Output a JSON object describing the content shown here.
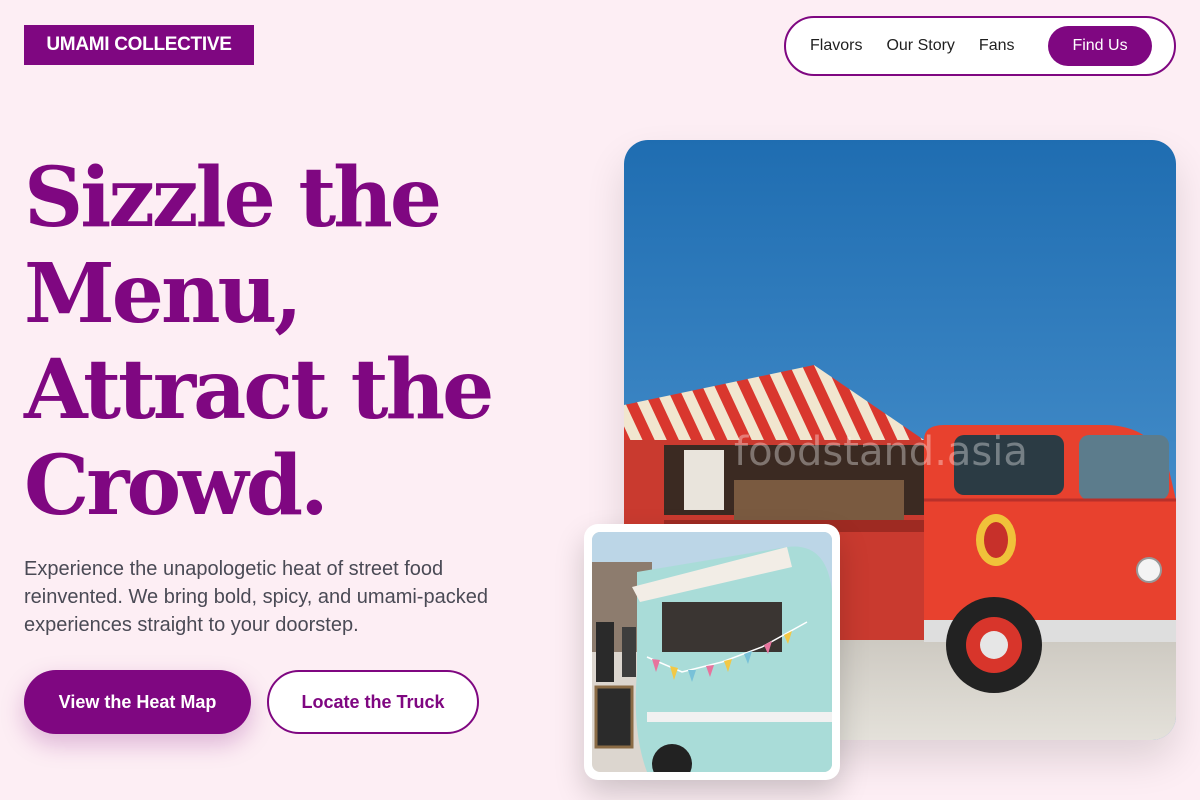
{
  "brand": {
    "logo_text": "UMAMI COLLECTIVE"
  },
  "nav": {
    "links": [
      "Flavors",
      "Our Story",
      "Fans"
    ],
    "cta_label": "Find Us"
  },
  "hero": {
    "headline_lines": [
      "Sizzle the",
      "Menu,",
      "Attract the",
      "Crowd."
    ],
    "description_lines": [
      "Experience the unapologetic heat of street food",
      "reinvented. We bring bold, spicy, and umami-packed",
      "experiences straight to your doorstep."
    ],
    "primary_button": "View the Heat Map",
    "secondary_button": "Locate the Truck"
  },
  "images": {
    "main_photo": {
      "watermark_text": "foodstand.asia"
    },
    "inset_photo": {}
  },
  "colors": {
    "brand": "#7f0781",
    "background": "#fdeef4",
    "sky": "#2f79b5",
    "truck_red": "#e0412e",
    "van_mint": "#a9dcd8"
  }
}
